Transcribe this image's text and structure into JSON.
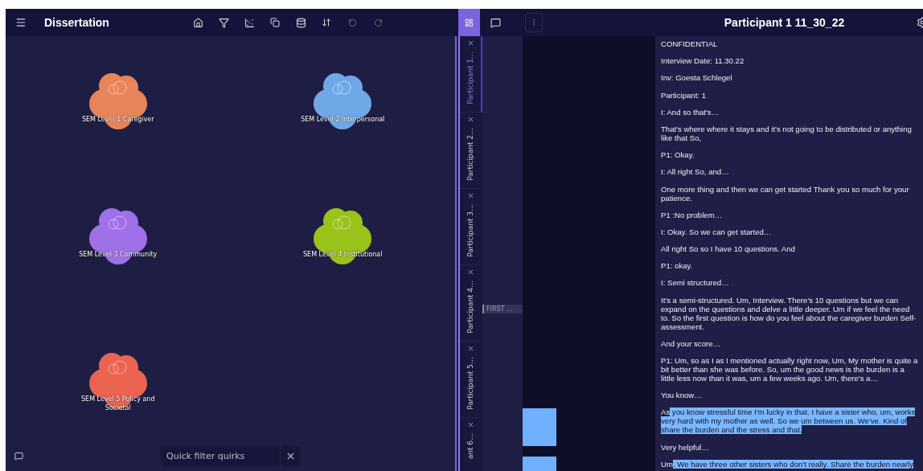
{
  "app": {
    "title": "Dissertation"
  },
  "canvas": {
    "clusters": [
      {
        "label": "SEM Level 1 Caregiver",
        "color": "#e8845a"
      },
      {
        "label": "SEM Level 2 Interpersonal",
        "color": "#6fa8e6"
      },
      {
        "label": "SEM Level 3 Community",
        "color": "#a070e8"
      },
      {
        "label": "SEM Level 4 Institutional",
        "color": "#99c21a"
      },
      {
        "label": "SEM Level 5 Policy and Societal",
        "color": "#ea6450"
      }
    ],
    "quick_filter": {
      "placeholder": "Quick filter quirks"
    }
  },
  "document_tabs": [
    {
      "label": "Participant 1…",
      "selected": true
    },
    {
      "label": "Participant 2…",
      "selected": false
    },
    {
      "label": "Participant 3…",
      "selected": false
    },
    {
      "label": "Participant 4…",
      "selected": false
    },
    {
      "label": "Participant 5…",
      "selected": false
    },
    {
      "label": "ant 6…",
      "selected": false
    }
  ],
  "margin": {
    "tag": "FIRST ..."
  },
  "document": {
    "title": "Participant 1 11_30_22",
    "paragraphs": [
      [
        {
          "text": "CONFIDENTIAL",
          "highlighted": false
        }
      ],
      [
        {
          "text": "Interview Date:  11.30.22",
          "highlighted": false
        }
      ],
      [
        {
          "text": "Inv:  Goesta Schlegel",
          "highlighted": false
        }
      ],
      [
        {
          "text": "Participant:  1",
          "highlighted": false
        }
      ],
      [
        {
          "text": "I: And so that's…",
          "highlighted": false
        }
      ],
      [
        {
          "text": "That's where where it stays and it's not going to be distributed or anything like that So,",
          "highlighted": false
        }
      ],
      [
        {
          "text": "P1: Okay.",
          "highlighted": false
        }
      ],
      [
        {
          "text": "I: All right So, and…",
          "highlighted": false
        }
      ],
      [
        {
          "text": "One more thing and then we can get started Thank you so much for your patience.",
          "highlighted": false
        }
      ],
      [
        {
          "text": "P1 :No problem…",
          "highlighted": false
        }
      ],
      [
        {
          "text": "I: Okay. So we can get started…",
          "highlighted": false
        }
      ],
      [
        {
          "text": "All right So so I have 10 questions. And",
          "highlighted": false
        }
      ],
      [
        {
          "text": "P1: okay.",
          "highlighted": false
        }
      ],
      [
        {
          "text": "I: Semi structured…",
          "highlighted": false
        }
      ],
      [
        {
          "text": "It's a semi-structured. Um, Interview. There's 10 questions but we can expand on the questions and delve a little deeper. Um if we feel the need to. So the first question is how do you feel about the caregiver burden Self-assessment.",
          "highlighted": false
        }
      ],
      [
        {
          "text": "And your score…",
          "highlighted": false
        }
      ],
      [
        {
          "text": "P1: Um, so as I as I mentioned actually right now, Um, My mother is quite a bit better than she was before. So, um the good news is the burden is a little less now than it was, um a few weeks ago. Um, there's a…",
          "highlighted": false
        }
      ],
      [
        {
          "text": "You know…",
          "highlighted": false
        }
      ],
      [
        {
          "text": "As",
          "highlighted": false
        },
        {
          "text": " you know stressful time I'm lucky in that. I have a sister who, um, works very hard with my mother as well. So we um between us. We've. Kind of share the burden and the stress and that.",
          "highlighted": true
        }
      ],
      [
        {
          "text": "V",
          "highlighted": false
        },
        {
          "text": "ery helpful…",
          "highlighted": false
        }
      ],
      [
        {
          "text": "Um",
          "highlighted": false
        },
        {
          "text": ". We have three other sisters who don't really. Share the burden nearly",
          "highlighted": true
        }
      ]
    ]
  }
}
